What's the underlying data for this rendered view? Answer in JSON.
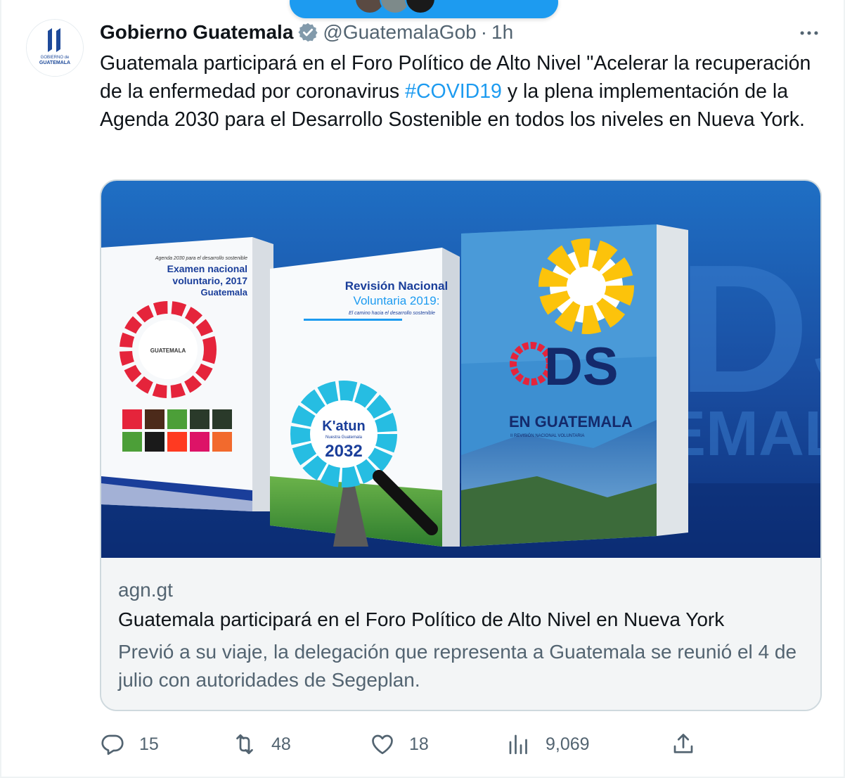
{
  "tweet": {
    "display_name": "Gobierno Guatemala",
    "handle": "@GuatemalaGob",
    "separator": "·",
    "time": "1h",
    "text_before_hashtag": "Guatemala participará en el Foro Político de Alto Nivel \"Acelerar la recuperación de la enfermedad por coronavirus ",
    "hashtag": "#COVID19",
    "text_after_hashtag": " y la plena implementación de la Agenda 2030 para el Desarrollo Sostenible en todos los niveles en Nueva York.",
    "avatar_logo_text_1": "GOBIERNO de",
    "avatar_logo_text_2": "GUATEMALA"
  },
  "card": {
    "domain": "agn.gt",
    "title": "Guatemala participará en el Foro Político de Alto Nivel en Nueva York",
    "description": "Previó a su viaje, la delegación que representa a Guatemala se reunió el 4 de julio con autoridades de Segeplan.",
    "image": {
      "book1": {
        "subtitle": "Agenda 2030 para el desarrollo sostenible",
        "title_1": "Examen nacional",
        "title_2": "voluntario, 2017",
        "title_3": "Guatemala",
        "wheel_label": "GUATEMALA"
      },
      "book2": {
        "title_1": "Revisión Nacional",
        "title_2": "Voluntaria 2019:",
        "subtitle": "El camino hacia el desarrollo sostenible",
        "badge_1": "K'atun",
        "badge_sub": "Nuestra Guatemala",
        "badge_2": "2032"
      },
      "book3": {
        "title": "DS",
        "subtitle": "EN GUATEMALA",
        "caption": "II REVISIÓN NACIONAL VOLUNTARIA"
      },
      "background_text_1": "DS",
      "background_text_2": "EMALA"
    }
  },
  "actions": {
    "replies": "15",
    "retweets": "48",
    "likes": "18",
    "views": "9,069"
  },
  "icons": [
    "verified-badge-icon",
    "more-icon",
    "reply-icon",
    "retweet-icon",
    "like-icon",
    "views-icon",
    "share-icon"
  ],
  "colors": {
    "accent": "#1d9bf0",
    "text_primary": "#0f1419",
    "text_secondary": "#536471",
    "border": "#cfd9de",
    "verified_badge": "#829aab"
  }
}
